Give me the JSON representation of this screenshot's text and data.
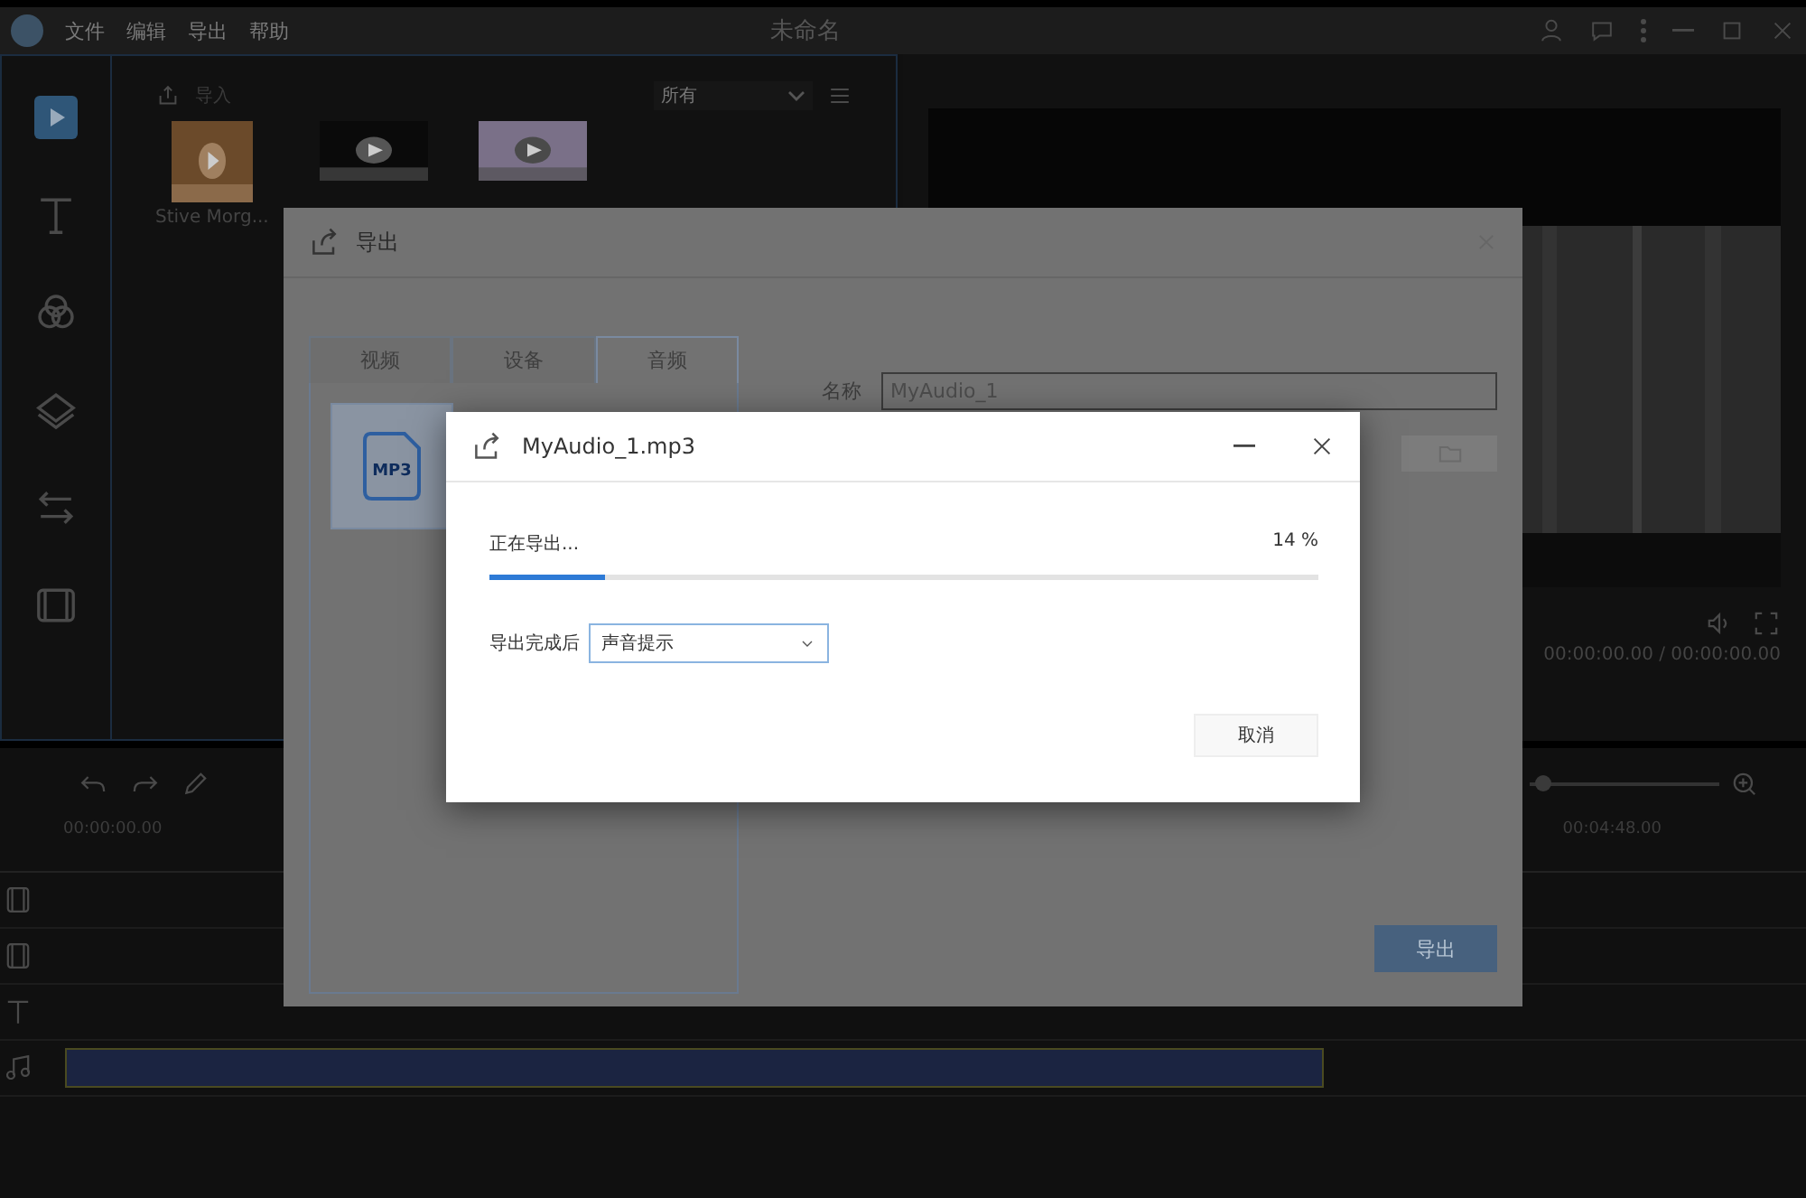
{
  "window": {
    "title": "未命名"
  },
  "menu": [
    "文件",
    "编辑",
    "导出",
    "帮助"
  ],
  "tool_rail": [
    {
      "kind": "media",
      "selected": true
    },
    {
      "kind": "text",
      "selected": false
    },
    {
      "kind": "filter",
      "selected": false
    },
    {
      "kind": "overlay",
      "selected": false
    },
    {
      "kind": "transition",
      "selected": false
    },
    {
      "kind": "film",
      "selected": false
    }
  ],
  "media_panel": {
    "import_label": "导入",
    "filter": "所有",
    "items": [
      {
        "kind": "picture",
        "label": "Stive Morg..."
      },
      {
        "kind": "picture"
      },
      {
        "kind": "picture"
      }
    ]
  },
  "preview": {
    "time": "00:00:00.00 / 00:00:00.00"
  },
  "timeline": {
    "ruler": [
      "00:00:00.00",
      "00:04:48.00"
    ],
    "zoom": {
      "level": 0.03
    },
    "tracks": [
      {
        "kind": "video"
      },
      {
        "kind": "video"
      },
      {
        "kind": "text"
      },
      {
        "kind": "audio"
      }
    ]
  },
  "export_dialog": {
    "title": "导出",
    "tabs": [
      {
        "label": "视频",
        "selected": false
      },
      {
        "label": "设备",
        "selected": false
      },
      {
        "label": "音频",
        "selected": true
      }
    ],
    "formats": [
      {
        "label": "MP3",
        "selected": true
      }
    ],
    "name_label": "名称",
    "name_value": "MyAudio_1",
    "export_button": "导出"
  },
  "progress_dialog": {
    "title": "MyAudio_1.mp3",
    "status": "正在导出...",
    "percent": "14 %",
    "progress": {
      "level": 0.14
    },
    "after_label": "导出完成后",
    "after_value": "声音提示",
    "cancel": "取消"
  }
}
